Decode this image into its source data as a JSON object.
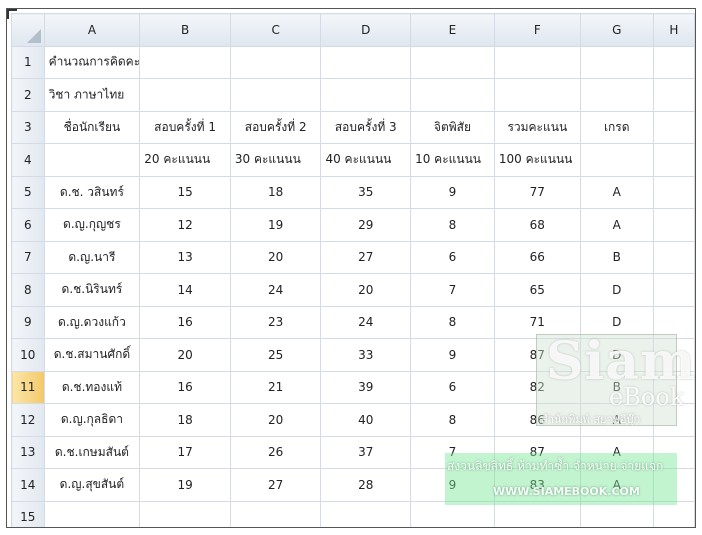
{
  "columns": [
    "A",
    "B",
    "C",
    "D",
    "E",
    "F",
    "G",
    "H"
  ],
  "rows": [
    {
      "num": "1",
      "cells": []
    },
    {
      "num": "2",
      "cells": []
    },
    {
      "num": "3",
      "cells": [
        "ชื่อนักเรียน",
        "สอบครั้งที่ 1",
        "สอบครั้งที่ 2",
        "สอบครั้งที่ 3",
        "จิตพิสัย",
        "รวมคะแนน",
        "เกรด",
        ""
      ]
    },
    {
      "num": "4",
      "cells": [
        "",
        "20 คะแนนน",
        "30 คะแนนน",
        "40 คะแนนน",
        "10 คะแนนน",
        "100 คะแนนน",
        "",
        ""
      ]
    },
    {
      "num": "5",
      "cells": [
        "ด.ช. วสินทร์",
        "15",
        "18",
        "35",
        "9",
        "77",
        "A",
        ""
      ]
    },
    {
      "num": "6",
      "cells": [
        "ด.ญ.กุญชร",
        "12",
        "19",
        "29",
        "8",
        "68",
        "A",
        ""
      ]
    },
    {
      "num": "7",
      "cells": [
        "ด.ญ.นารี",
        "13",
        "20",
        "27",
        "6",
        "66",
        "B",
        ""
      ]
    },
    {
      "num": "8",
      "cells": [
        "ด.ช.นิรินทร์",
        "14",
        "24",
        "20",
        "7",
        "65",
        "D",
        ""
      ]
    },
    {
      "num": "9",
      "cells": [
        "ด.ญ.ดวงแก้ว",
        "16",
        "23",
        "24",
        "8",
        "71",
        "D",
        ""
      ]
    },
    {
      "num": "10",
      "cells": [
        "ด.ช.สมานศักดิ์",
        "20",
        "25",
        "33",
        "9",
        "87",
        "D",
        ""
      ]
    },
    {
      "num": "11",
      "cells": [
        "ด.ช.ทองแท้",
        "16",
        "21",
        "39",
        "6",
        "82",
        "B",
        ""
      ]
    },
    {
      "num": "12",
      "cells": [
        "ด.ญ.กุลธิดา",
        "18",
        "20",
        "40",
        "8",
        "86",
        "A",
        ""
      ]
    },
    {
      "num": "13",
      "cells": [
        "ด.ช.เกษมสันต์",
        "17",
        "26",
        "37",
        "7",
        "87",
        "A",
        ""
      ]
    },
    {
      "num": "14",
      "cells": [
        "ด.ญ.สุขสันต์",
        "19",
        "27",
        "28",
        "9",
        "83",
        "A",
        ""
      ]
    },
    {
      "num": "15",
      "cells": []
    }
  ],
  "title_row1": "คำนวณการคิดคะแนนและเกรดของนักเรียน",
  "title_row2": "วิชา ภาษาไทย",
  "active_row": "11",
  "watermark": {
    "logo": "Siam",
    "ebook": "eBook",
    "sub": "สำนักพิมพ์ สยามอีบุ๊ก",
    "copyright": "สงวนลิขสิทธิ์ ห้ามทำซ้ำ จำหน่าย จ่ายแจก",
    "url": "WWW.SIAMEBOOK.COM"
  }
}
